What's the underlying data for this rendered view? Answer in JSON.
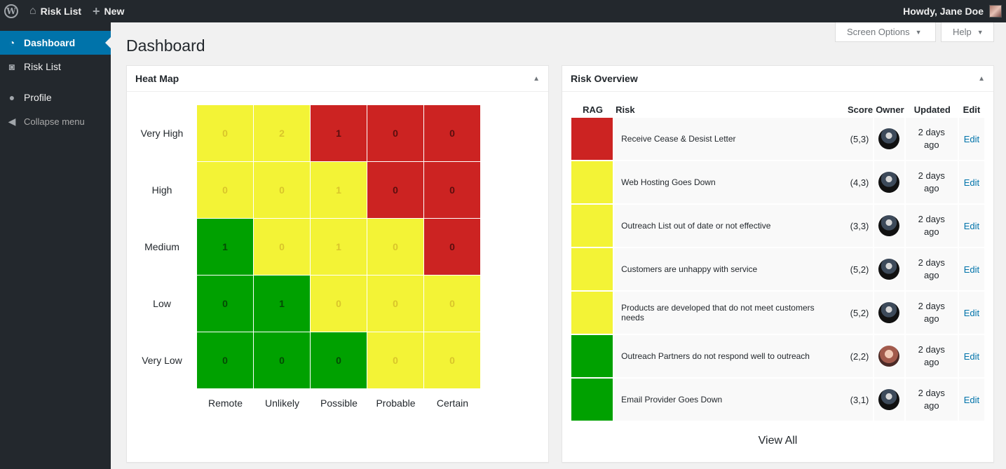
{
  "adminbar": {
    "site_name": "Risk List",
    "new_label": "New",
    "howdy": "Howdy, Jane Doe"
  },
  "sidebar": {
    "items": [
      {
        "label": "Dashboard",
        "icon": "dashboard-icon",
        "current": true
      },
      {
        "label": "Risk List",
        "icon": "risk-list-icon"
      },
      {
        "label": "Profile",
        "icon": "profile-icon"
      },
      {
        "label": "Collapse menu",
        "icon": "collapse-icon"
      }
    ]
  },
  "screen_options": "Screen Options",
  "help": "Help",
  "page_title": "Dashboard",
  "heatmap": {
    "title": "Heat Map",
    "rows": [
      "Very High",
      "High",
      "Medium",
      "Low",
      "Very Low"
    ],
    "columns": [
      "Remote",
      "Unlikely",
      "Possible",
      "Probable",
      "Certain"
    ],
    "cells": [
      [
        {
          "v": "0",
          "c": "yellow"
        },
        {
          "v": "2",
          "c": "yellow"
        },
        {
          "v": "1",
          "c": "red"
        },
        {
          "v": "0",
          "c": "red"
        },
        {
          "v": "0",
          "c": "red"
        }
      ],
      [
        {
          "v": "0",
          "c": "yellow"
        },
        {
          "v": "0",
          "c": "yellow"
        },
        {
          "v": "1",
          "c": "yellow"
        },
        {
          "v": "0",
          "c": "red"
        },
        {
          "v": "0",
          "c": "red"
        }
      ],
      [
        {
          "v": "1",
          "c": "green"
        },
        {
          "v": "0",
          "c": "yellow"
        },
        {
          "v": "1",
          "c": "yellow"
        },
        {
          "v": "0",
          "c": "yellow"
        },
        {
          "v": "0",
          "c": "red"
        }
      ],
      [
        {
          "v": "0",
          "c": "green"
        },
        {
          "v": "1",
          "c": "green"
        },
        {
          "v": "0",
          "c": "yellow"
        },
        {
          "v": "0",
          "c": "yellow"
        },
        {
          "v": "0",
          "c": "yellow"
        }
      ],
      [
        {
          "v": "0",
          "c": "green"
        },
        {
          "v": "0",
          "c": "green"
        },
        {
          "v": "0",
          "c": "green"
        },
        {
          "v": "0",
          "c": "yellow"
        },
        {
          "v": "0",
          "c": "yellow"
        }
      ]
    ]
  },
  "overview": {
    "title": "Risk Overview",
    "headers": [
      "RAG",
      "Risk",
      "Score",
      "Owner",
      "Updated",
      "Edit"
    ],
    "rows": [
      {
        "rag": "#cc2322",
        "risk": "Receive Cease & Desist Letter",
        "score": "(5,3)",
        "owner_avatar": "dark",
        "updated": [
          "2 days",
          "ago"
        ],
        "edit": "Edit"
      },
      {
        "rag": "#f3f336",
        "risk": "Web Hosting Goes Down",
        "score": "(4,3)",
        "owner_avatar": "dark",
        "updated": [
          "2 days",
          "ago"
        ],
        "edit": "Edit"
      },
      {
        "rag": "#f3f336",
        "risk": "Outreach List out of date or not effective",
        "score": "(3,3)",
        "owner_avatar": "dark",
        "updated": [
          "2 days",
          "ago"
        ],
        "edit": "Edit"
      },
      {
        "rag": "#f3f336",
        "risk": "Customers are unhappy with service",
        "score": "(5,2)",
        "owner_avatar": "dark",
        "updated": [
          "2 days",
          "ago"
        ],
        "edit": "Edit"
      },
      {
        "rag": "#f3f336",
        "risk": "Products are developed that do not meet customers needs",
        "score": "(5,2)",
        "owner_avatar": "dark",
        "updated": [
          "2 days",
          "ago"
        ],
        "edit": "Edit"
      },
      {
        "rag": "#00a100",
        "risk": "Outreach Partners do not respond well to outreach",
        "score": "(2,2)",
        "owner_avatar": "alt",
        "updated": [
          "2 days",
          "ago"
        ],
        "edit": "Edit"
      },
      {
        "rag": "#00a100",
        "risk": "Email Provider Goes Down",
        "score": "(3,1)",
        "owner_avatar": "dark",
        "updated": [
          "2 days",
          "ago"
        ],
        "edit": "Edit"
      }
    ],
    "view_all": "View All"
  }
}
